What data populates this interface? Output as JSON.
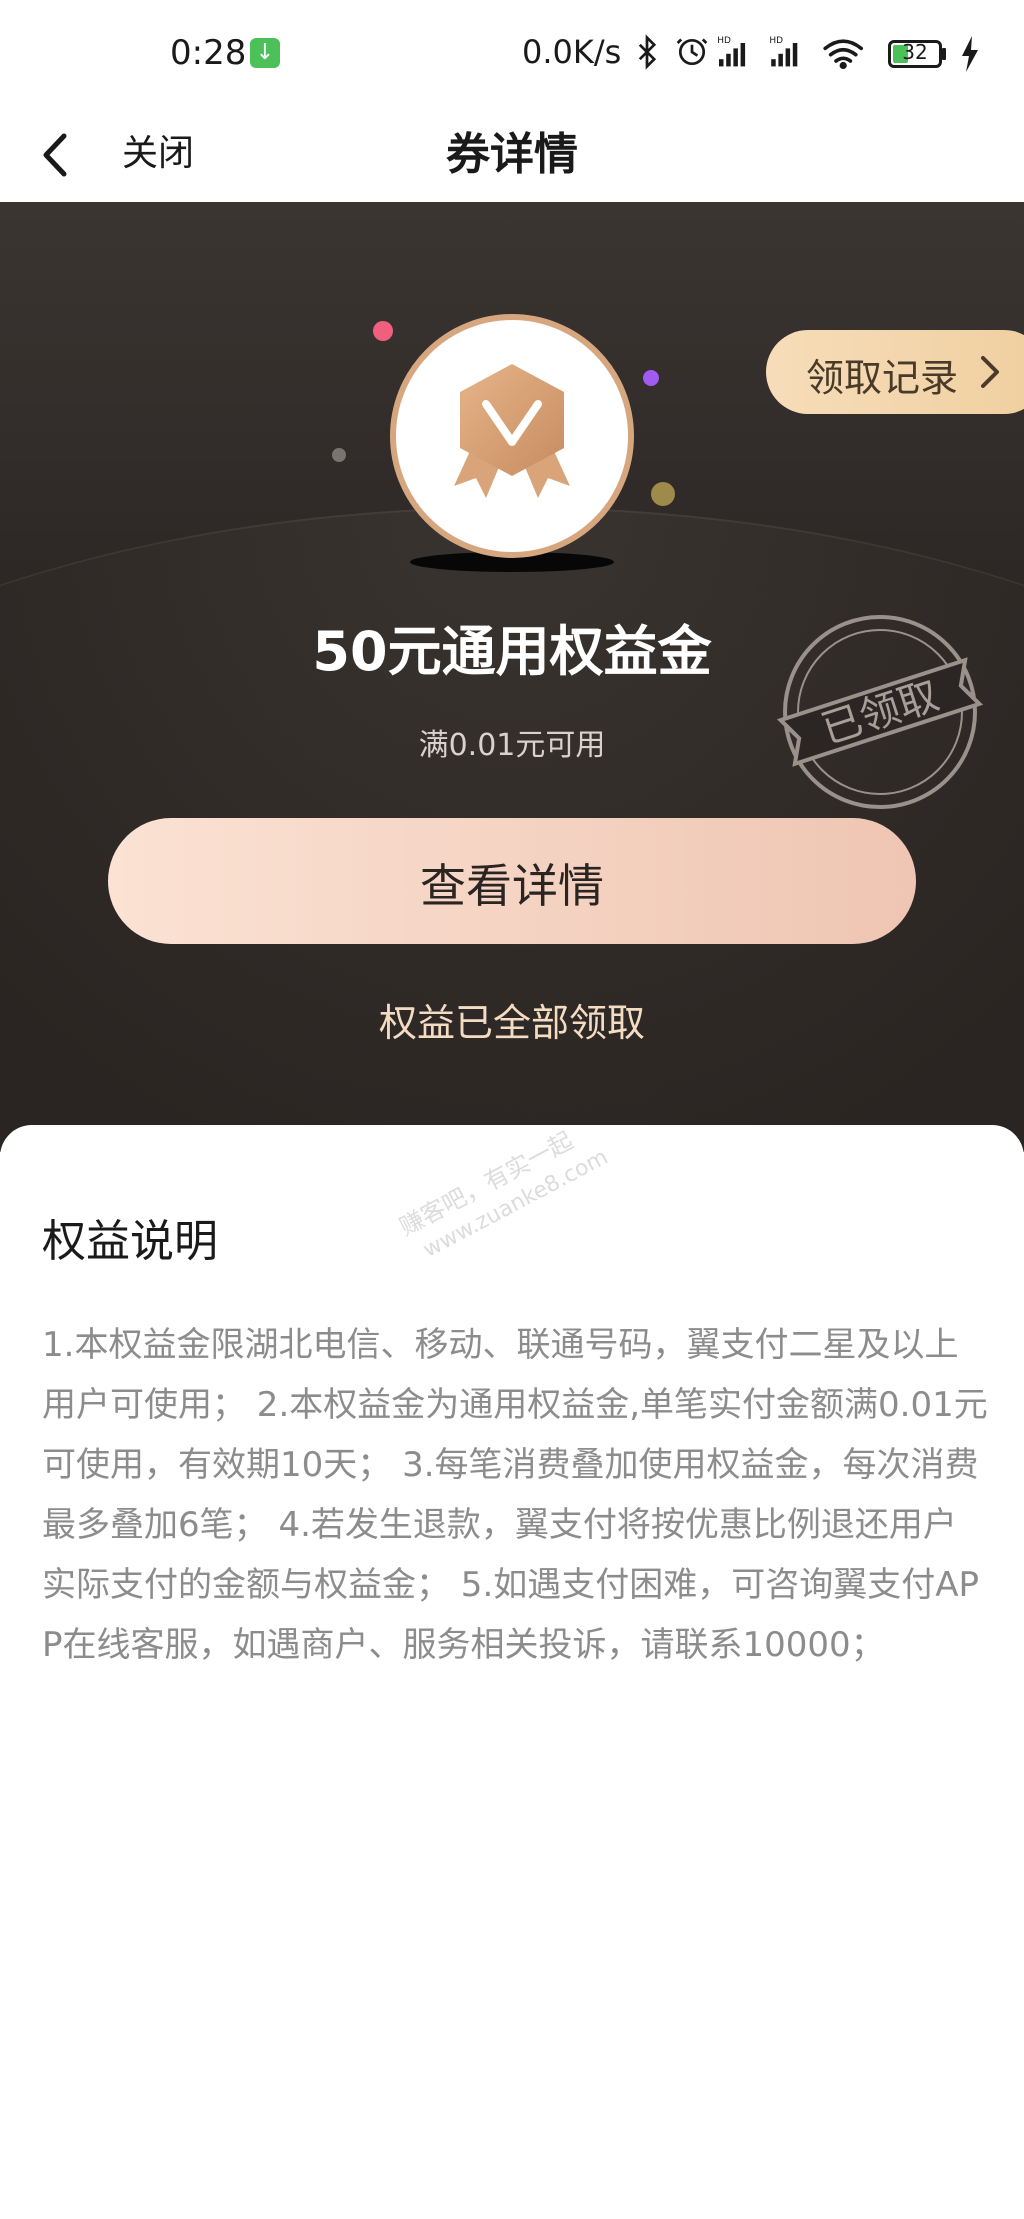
{
  "status_bar": {
    "time": "0:28",
    "network_speed": "0.0K/s",
    "battery_level": "32",
    "battery_percent": 32,
    "icons": [
      "download-icon",
      "bluetooth-icon",
      "alarm-icon",
      "signal-hd-icon",
      "signal-hd-icon",
      "wifi-icon",
      "battery-icon",
      "charging-icon"
    ]
  },
  "navbar": {
    "close_label": "关闭",
    "title": "券详情"
  },
  "coupon": {
    "records_label": "领取记录",
    "title": "50元通用权益金",
    "condition": "满0.01元可用",
    "stamp_text": "已领取",
    "detail_button": "查看详情",
    "status_text": "权益已全部领取"
  },
  "rules": {
    "title": "权益说明",
    "body": "1.本权益金限湖北电信、移动、联通号码，翼支付二星及以上用户可使用； 2.本权益金为通用权益金,单笔实付金额满0.01元可使用，有效期10天； 3.每笔消费叠加使用权益金，每次消费最多叠加6笔； 4.若发生退款，翼支付将按优惠比例退还用户实际支付的金额与权益金； 5.如遇支付困难，可咨询翼支付APP在线客服，如遇商户、服务相关投诉，请联系10000；"
  },
  "watermark": {
    "line1": "赚客吧，有实一起",
    "line2": "www.zuanke8.com"
  },
  "colors": {
    "hero_bg": "#2b2624",
    "accent_gold": "#d6a77f",
    "button_peach": "#fbe2d3",
    "records_gold": "#f6ddb9"
  }
}
